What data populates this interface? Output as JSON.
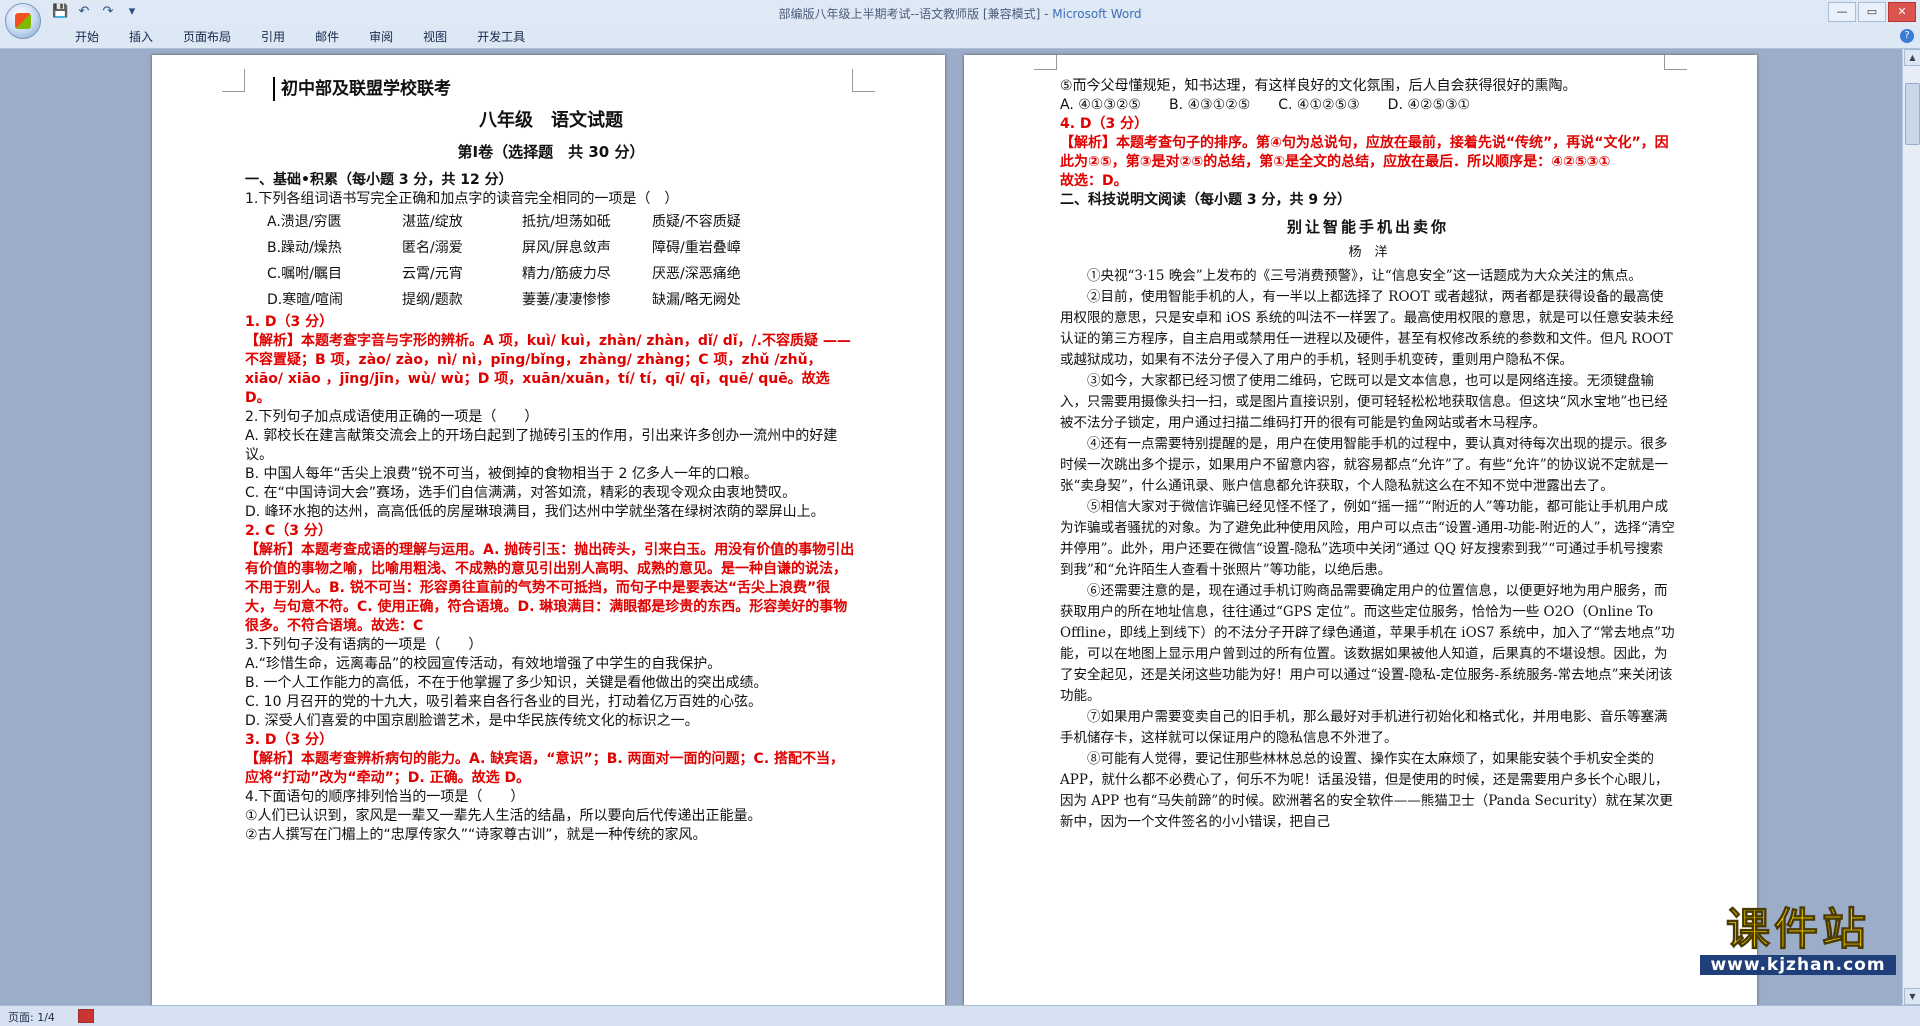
{
  "window": {
    "title": "部编版八年级上半期考试--语文教师版 [兼容模式] - ",
    "app_name": "Microsoft Word",
    "controls": [
      "—",
      "▭",
      "✕"
    ]
  },
  "qat": {
    "save_icon": "💾",
    "undo_icon": "↶",
    "redo_icon": "↷",
    "menu_icon": "▾"
  },
  "ribbon": {
    "tabs": [
      "开始",
      "插入",
      "页面布局",
      "引用",
      "邮件",
      "审阅",
      "视图",
      "开发工具"
    ],
    "help_icon": "?"
  },
  "page1": {
    "school": "初中部及联盟学校联考",
    "grade_title": "八年级　语文试题",
    "volume": "第Ⅰ卷（选择题　共 30 分）",
    "section1": "一、基础•积累（每小题 3 分，共 12 分）",
    "q1": "1.下列各组词语书写完全正确和加点字的读音完全相同的一项是（　）",
    "q1_options": [
      [
        "A.溃退/穷匮",
        "湛蓝/绽放",
        "抵抗/坦荡如砥",
        "质疑/不容质疑"
      ],
      [
        "B.躁动/燥热",
        "匿名/溺爱",
        "屏风/屏息敛声",
        "障碍/重岩叠嶂"
      ],
      [
        "C.嘱咐/瞩目",
        "云霄/元宵",
        "精力/筋疲力尽",
        "厌恶/深恶痛绝"
      ],
      [
        "D.寒暄/喧闹",
        "提纲/题款",
        "萋萋/凄凄惨惨",
        "缺漏/略无阙处"
      ]
    ],
    "a1": "1. D（3 分）",
    "e1": "【解析】本题考查字音与字形的辨析。A 项，kuì/ kuì，zhàn/ zhàn，dǐ/ dǐ，/.不容质疑 ——不容置疑；B 项，zào/ zào，nì/ nì，pīng/bǐng，zhàng/ zhàng；C 项，zhǔ /zhǔ，xiāo/ xiāo ，jīng/jīn，wù/ wù；D 项，xuān/xuān，tí/ tí，qī/ qī，quē/ quē。故选 D。",
    "q2": "2.下列句子加点成语使用正确的一项是（　　）",
    "q2_options": [
      "A. 郭校长在建言献策交流会上的开场白起到了抛砖引玉的作用，引出来许多创办一流州中的好建议。",
      "B. 中国人每年“舌尖上浪费”锐不可当，被倒掉的食物相当于 2 亿多人一年的口粮。",
      "C. 在“中国诗词大会”赛场，选手们自信满满，对答如流，精彩的表现令观众由衷地赞叹。",
      "D. 峰环水抱的达州，高高低低的房屋琳琅满目，我们达州中学就坐落在绿树浓荫的翠屏山上。"
    ],
    "a2": "2. C（3 分）",
    "e2": "【解析】本题考查成语的理解与运用。A. 抛砖引玉：抛出砖头，引来白玉。用没有价值的事物引出有价值的事物之喻，比喻用粗浅、不成熟的意见引出别人高明、成熟的意见。是一种自谦的说法，不用于别人。B. 锐不可当：形容勇往直前的气势不可抵挡，而句子中是要表达“舌尖上浪费”很大，与句意不符。C. 使用正确，符合语境。D. 琳琅满目：满眼都是珍贵的东西。形容美好的事物很多。不符合语境。故选：C",
    "q3": "3.下列句子没有语病的一项是（　　）",
    "q3_options": [
      "A.“珍惜生命，远离毒品”的校园宣传活动，有效地增强了中学生的自我保护。",
      "B. 一个人工作能力的高低，不在于他掌握了多少知识，关键是看他做出的突出成绩。",
      "C. 10 月召开的党的十九大，吸引着来自各行各业的目光，打动着亿万百姓的心弦。",
      "D. 深受人们喜爱的中国京剧脸谱艺术，是中华民族传统文化的标识之一。"
    ],
    "a3": "3. D（3 分）",
    "e3": "【解析】本题考查辨析病句的能力。A. 缺宾语，“意识”；B. 两面对一面的问题；C. 搭配不当，应将“打动”改为“牵动”；D. 正确。故选 D。",
    "q4": "4.下面语句的顺序排列恰当的一项是（　　）",
    "q4_lines": [
      "①人们已认识到，家风是一辈又一辈先人生活的结晶，所以要向后代传递出正能量。",
      "②古人撰写在门楣上的“忠厚传家久”“诗家尊古训”，就是一种传统的家风。"
    ]
  },
  "page2": {
    "line5": "⑤而今父母懂规矩，知书达理，有这样良好的文化氛围，后人自会获得很好的熏陶。",
    "q4_options": "A. ④①③②⑤　　B. ④③①②⑤　　C. ④①②⑤③　　D. ④②⑤③①",
    "a4": "4. D（3 分）",
    "e4": "【解析】本题考查句子的排序。第④句为总说句，应放在最前，接着先说“传统”，再说“文化”，因此为②⑤，第③是对②⑤的总结，第①是全文的总结，应放在最后．所以顺序是：④②⑤③①",
    "e4_end": "故选：D。",
    "section2": "二、科技说明文阅读（每小题 3 分，共 9 分）",
    "article_title": "别让智能手机出卖你",
    "author": "杨　洋",
    "paragraphs": [
      "①央视“3·15 晚会”上发布的《三号消费预警》，让“信息安全”这一话题成为大众关注的焦点。",
      "②目前，使用智能手机的人，有一半以上都选择了 ROOT 或者越狱，两者都是获得设备的最高使用权限的意思，只是安卓和 iOS 系统的叫法不一样罢了。最高使用权限的意思，就是可以任意安装未经认证的第三方程序，自主启用或禁用任一进程以及硬件，甚至有权修改系统的参数和文件。但凡 ROOT 或越狱成功，如果有不法分子侵入了用户的手机，轻则手机变砖，重则用户隐私不保。",
      "③如今，大家都已经习惯了使用二维码，它既可以是文本信息，也可以是网络连接。无须键盘输入，只需要用摄像头扫一扫，或是图片直接识别，便可轻轻松松地获取信息。但这块“风水宝地”也已经被不法分子锁定，用户通过扫描二维码打开的很有可能是钓鱼网站或者木马程序。",
      "④还有一点需要特别提醒的是，用户在使用智能手机的过程中，要认真对待每次出现的提示。很多时候一次跳出多个提示，如果用户不留意内容，就容易都点“允许”了。有些“允许”的协议说不定就是一张“卖身契”，什么通讯录、账户信息都允许获取，个人隐私就这么在不知不觉中泄露出去了。",
      "⑤相信大家对于微信诈骗已经见怪不怪了，例如“摇一摇”“附近的人”等功能，都可能让手机用户成为诈骗或者骚扰的对象。为了避免此种使用风险，用户可以点击“设置-通用-功能-附近的人”，选择“清空并停用”。此外，用户还要在微信“设置-隐私”选项中关闭“通过 QQ 好友搜索到我”“可通过手机号搜索到我”和“允许陌生人查看十张照片”等功能，以绝后患。",
      "⑥还需要注意的是，现在通过手机订购商品需要确定用户的位置信息，以便更好地为用户服务，而获取用户的所在地址信息，往往通过“GPS 定位”。而这些定位服务，恰恰为一些 O2O（Online To Offline，即线上到线下）的不法分子开辟了绿色通道，苹果手机在 iOS7 系统中，加入了“常去地点”功能，可以在地图上显示用户曾到过的所有位置。该数据如果被他人知道，后果真的不堪设想。因此，为了安全起见，还是关闭这些功能为好！用户可以通过“设置-隐私-定位服务-系统服务-常去地点”来关闭该功能。",
      "⑦如果用户需要变卖自己的旧手机，那么最好对手机进行初始化和格式化，并用电影、音乐等塞满手机储存卡，这样就可以保证用户的隐私信息不外泄了。",
      "⑧可能有人觉得，要记住那些林林总总的设置、操作实在太麻烦了，如果能安装个手机安全类的 APP，就什么都不必费心了，何乐不为呢！话虽没错，但是使用的时候，还是需要用户多长个心眼儿，因为 APP 也有“马失前蹄”的时候。欧洲著名的安全软件——熊猫卫士（Panda Security）就在某次更新中，因为一个文件签名的小小错误，把自己"
    ]
  },
  "status": {
    "page": "页面: 1/4"
  },
  "watermark": {
    "text": "课件站",
    "url": "www.kjzhan.com"
  }
}
